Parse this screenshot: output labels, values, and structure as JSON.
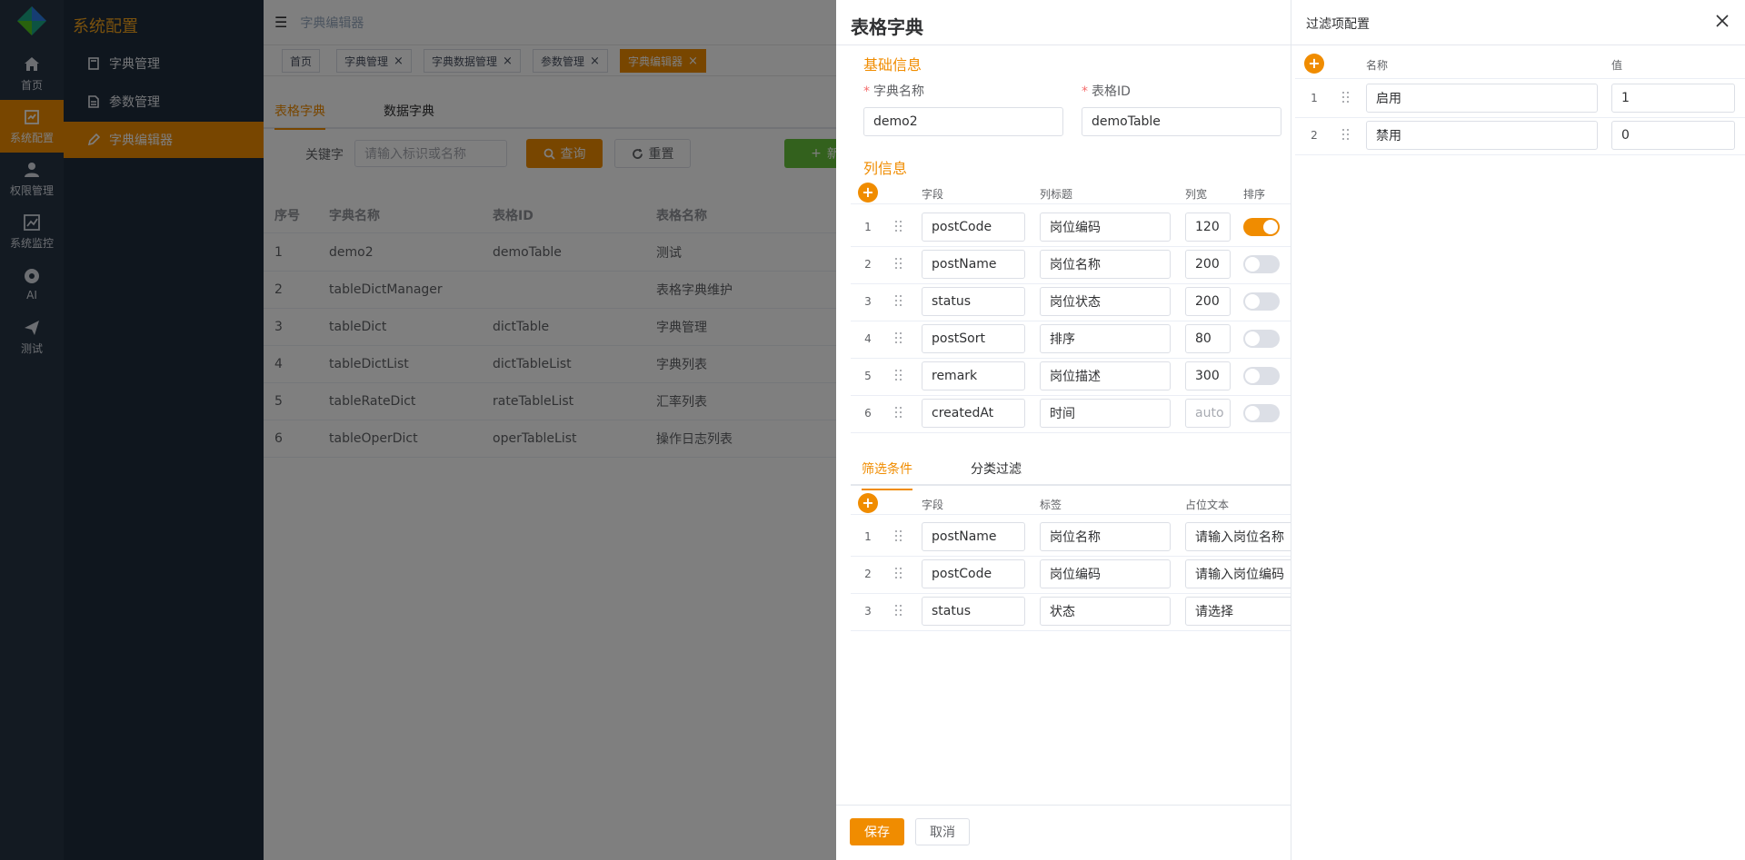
{
  "rail": {
    "items": [
      {
        "label": "首页",
        "icon": "home-icon"
      },
      {
        "label": "系统配置",
        "icon": "settings-icon"
      },
      {
        "label": "权限管理",
        "icon": "user-icon"
      },
      {
        "label": "系统监控",
        "icon": "chart-icon"
      },
      {
        "label": "AI",
        "icon": "chrome-icon"
      },
      {
        "label": "测试",
        "icon": "send-icon"
      }
    ]
  },
  "submenu": {
    "title": "系统配置",
    "items": [
      {
        "label": "字典管理",
        "icon": "document-icon"
      },
      {
        "label": "参数管理",
        "icon": "document-icon"
      },
      {
        "label": "字典编辑器",
        "icon": "edit-icon"
      }
    ]
  },
  "header": {
    "breadcrumb": "字典编辑器"
  },
  "tags": [
    {
      "label": "首页"
    },
    {
      "label": "字典管理"
    },
    {
      "label": "字典数据管理"
    },
    {
      "label": "参数管理"
    },
    {
      "label": "字典编辑器"
    }
  ],
  "page_tabs": [
    "表格字典",
    "数据字典"
  ],
  "search": {
    "keyword_label": "关键字",
    "keyword_placeholder": "请输入标识或名称",
    "query_label": "查询",
    "reset_label": "重置",
    "add_label": "新"
  },
  "table": {
    "headers": [
      "序号",
      "字典名称",
      "表格ID",
      "表格名称"
    ],
    "rows": [
      [
        "1",
        "demo2",
        "demoTable",
        "测试"
      ],
      [
        "2",
        "tableDictManager",
        "",
        "表格字典维护"
      ],
      [
        "3",
        "tableDict",
        "dictTable",
        "字典管理"
      ],
      [
        "4",
        "tableDictList",
        "dictTableList",
        "字典列表"
      ],
      [
        "5",
        "tableRateDict",
        "rateTableList",
        "汇率列表"
      ],
      [
        "6",
        "tableOperDict",
        "operTableList",
        "操作日志列表"
      ]
    ]
  },
  "drawer1": {
    "title": "表格字典",
    "basic": {
      "section": "基础信息",
      "dict_name_label": "字典名称",
      "dict_name_value": "demo2",
      "table_id_label": "表格ID",
      "table_id_value": "demoTable"
    },
    "columns": {
      "section": "列信息",
      "headers": [
        "字段",
        "列标题",
        "列宽",
        "排序"
      ],
      "rows": [
        {
          "num": "1",
          "field": "postCode",
          "title": "岗位编码",
          "width": "120",
          "sort": true
        },
        {
          "num": "2",
          "field": "postName",
          "title": "岗位名称",
          "width": "200",
          "sort": false
        },
        {
          "num": "3",
          "field": "status",
          "title": "岗位状态",
          "width": "200",
          "sort": false
        },
        {
          "num": "4",
          "field": "postSort",
          "title": "排序",
          "width": "80",
          "sort": false
        },
        {
          "num": "5",
          "field": "remark",
          "title": "岗位描述",
          "width": "300",
          "sort": false
        },
        {
          "num": "6",
          "field": "createdAt",
          "title": "时间",
          "width": "auto",
          "sort": false
        }
      ]
    },
    "filter_tabs": [
      "筛选条件",
      "分类过滤"
    ],
    "filters": {
      "headers": [
        "字段",
        "标签",
        "占位文本"
      ],
      "rows": [
        {
          "num": "1",
          "field": "postName",
          "label": "岗位名称",
          "placeholder": "请输入岗位名称"
        },
        {
          "num": "2",
          "field": "postCode",
          "label": "岗位编码",
          "placeholder": "请输入岗位编码"
        },
        {
          "num": "3",
          "field": "status",
          "label": "状态",
          "placeholder": "请选择"
        }
      ]
    },
    "save_label": "保存",
    "cancel_label": "取消"
  },
  "drawer2": {
    "title": "过滤项配置",
    "headers": [
      "名称",
      "值"
    ],
    "rows": [
      {
        "num": "1",
        "name": "启用",
        "value": "1"
      },
      {
        "num": "2",
        "name": "禁用",
        "value": "0"
      }
    ]
  },
  "colors": {
    "accent": "#f08c00",
    "success": "#67c23a",
    "rail_bg": "#263445",
    "submenu_bg": "#1f2d3d"
  }
}
